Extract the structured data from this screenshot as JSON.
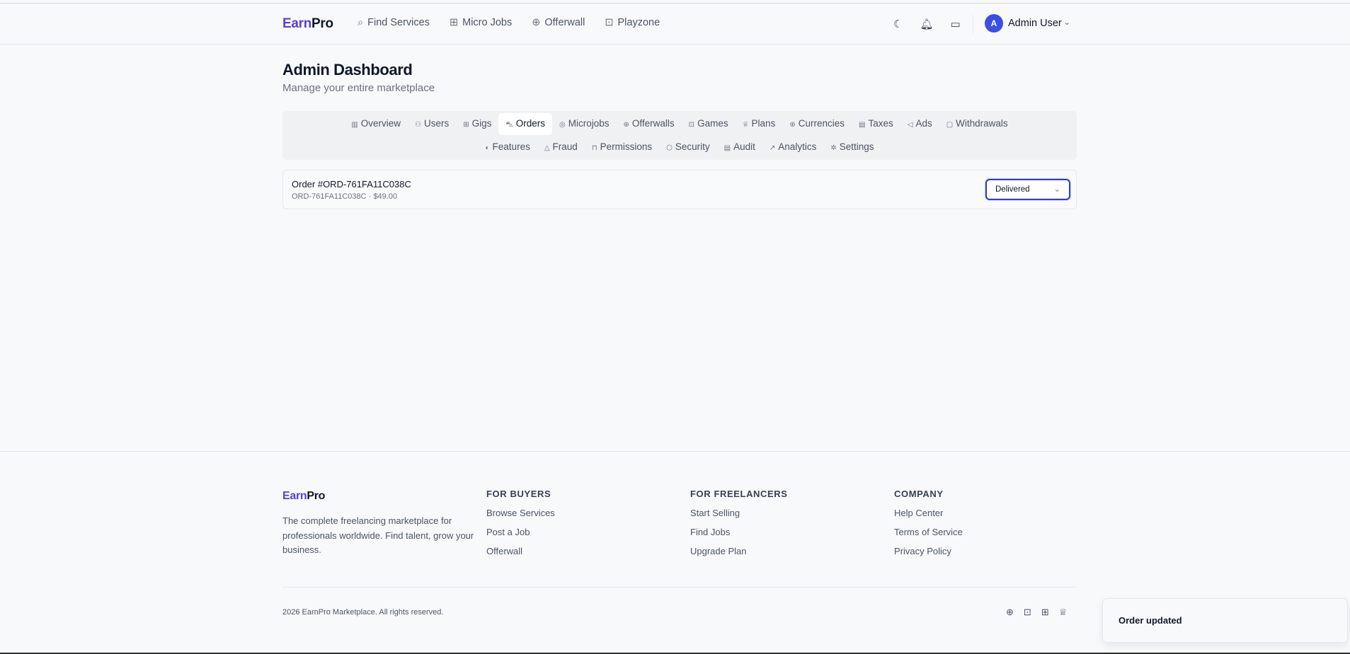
{
  "header": {
    "logo_a": "Earn",
    "logo_b": "Pro",
    "nav": [
      {
        "label": "Find Services",
        "icon": "search-icon"
      },
      {
        "label": "Micro Jobs",
        "icon": "briefcase-icon"
      },
      {
        "label": "Offerwall",
        "icon": "gift-icon"
      },
      {
        "label": "Playzone",
        "icon": "gamepad-icon"
      }
    ],
    "user": {
      "initial": "A",
      "name": "Admin User"
    }
  },
  "page": {
    "title": "Admin Dashboard",
    "subtitle": "Manage your entire marketplace"
  },
  "tabs_row1": [
    {
      "label": "Overview",
      "icon": "chart-icon"
    },
    {
      "label": "Users",
      "icon": "users-icon"
    },
    {
      "label": "Gigs",
      "icon": "briefcase-icon"
    },
    {
      "label": "Orders",
      "icon": "cart-icon",
      "active": true
    },
    {
      "label": "Microjobs",
      "icon": "target-icon"
    },
    {
      "label": "Offerwalls",
      "icon": "gift-icon"
    },
    {
      "label": "Games",
      "icon": "gamepad-icon"
    },
    {
      "label": "Plans",
      "icon": "crown-icon"
    },
    {
      "label": "Currencies",
      "icon": "globe-icon"
    },
    {
      "label": "Taxes",
      "icon": "receipt-icon"
    },
    {
      "label": "Ads",
      "icon": "megaphone-icon"
    },
    {
      "label": "Withdrawals",
      "icon": "wallet-icon"
    }
  ],
  "tabs_row2": [
    {
      "label": "Features",
      "icon": "toggle-icon"
    },
    {
      "label": "Fraud",
      "icon": "warning-icon"
    },
    {
      "label": "Permissions",
      "icon": "lock-icon"
    },
    {
      "label": "Security",
      "icon": "shield-icon"
    },
    {
      "label": "Audit",
      "icon": "file-icon"
    },
    {
      "label": "Analytics",
      "icon": "trend-icon"
    },
    {
      "label": "Settings",
      "icon": "gear-icon"
    }
  ],
  "order": {
    "title": "Order #ORD-761FA11C038C",
    "meta": "ORD-761FA11C038C · $49.00",
    "status": "Delivered"
  },
  "footer": {
    "logo_a": "Earn",
    "logo_b": "Pro",
    "description": "The complete freelancing marketplace for professionals worldwide. Find talent, grow your business.",
    "columns": [
      {
        "heading": "FOR BUYERS",
        "links": [
          "Browse Services",
          "Post a Job",
          "Offerwall"
        ]
      },
      {
        "heading": "FOR FREELANCERS",
        "links": [
          "Start Selling",
          "Find Jobs",
          "Upgrade Plan"
        ]
      },
      {
        "heading": "COMPANY",
        "links": [
          "Help Center",
          "Terms of Service",
          "Privacy Policy"
        ]
      }
    ],
    "copyright": "2026 EarnPro Marketplace. All rights reserved."
  },
  "toast": "Order updated",
  "colors": {
    "brand": "#5b3fd6",
    "accent": "#3b4fe0"
  }
}
